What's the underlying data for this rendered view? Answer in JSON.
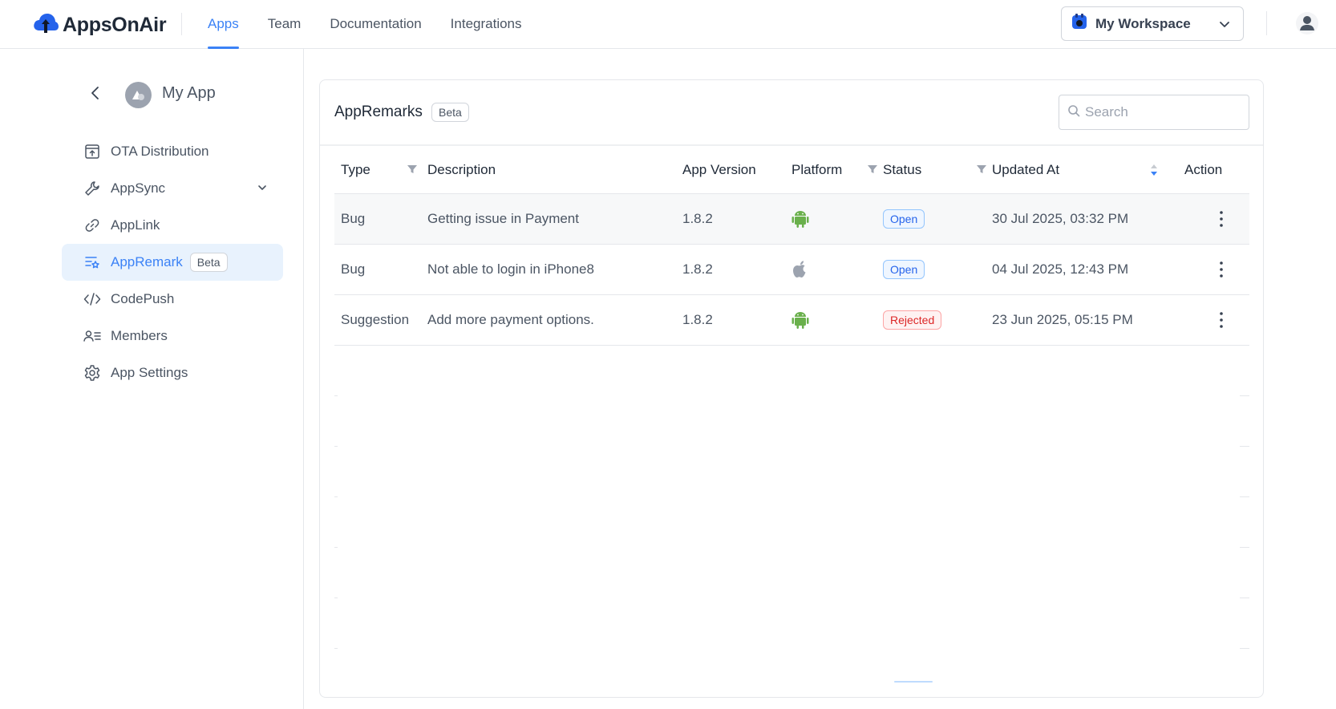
{
  "app": {
    "logo_text": "AppsOnAir"
  },
  "nav": {
    "items": [
      {
        "label": "Apps",
        "active": true
      },
      {
        "label": "Team",
        "active": false
      },
      {
        "label": "Documentation",
        "active": false
      },
      {
        "label": "Integrations",
        "active": false
      }
    ]
  },
  "workspace": {
    "label": "My Workspace",
    "icon": "workspace-icon"
  },
  "sidebar": {
    "app_name": "My App",
    "items": [
      {
        "label": "OTA Distribution",
        "icon": "upload-box-icon"
      },
      {
        "label": "AppSync",
        "icon": "wrench-icon",
        "expandable": true
      },
      {
        "label": "AppLink",
        "icon": "link-icon"
      },
      {
        "label": "AppRemark",
        "icon": "list-star-icon",
        "badge": "Beta",
        "active": true
      },
      {
        "label": "CodePush",
        "icon": "code-icon"
      },
      {
        "label": "Members",
        "icon": "members-icon"
      },
      {
        "label": "App Settings",
        "icon": "gear-icon"
      }
    ]
  },
  "card": {
    "title": "AppRemarks",
    "badge": "Beta",
    "search_placeholder": "Search"
  },
  "table": {
    "columns": [
      "Type",
      "Description",
      "App Version",
      "Platform",
      "Status",
      "Updated At",
      "Action"
    ],
    "rows": [
      {
        "type": "Bug",
        "description": "Getting issue in Payment",
        "version": "1.8.2",
        "platform": "android",
        "status": "Open",
        "updated": "30 Jul 2025, 03:32 PM"
      },
      {
        "type": "Bug",
        "description": "Not able to login in iPhone8",
        "version": "1.8.2",
        "platform": "ios",
        "status": "Open",
        "updated": "04 Jul 2025, 12:43 PM"
      },
      {
        "type": "Suggestion",
        "description": "Add more payment options.",
        "version": "1.8.2",
        "platform": "android",
        "status": "Rejected",
        "updated": "23 Jun 2025, 05:15 PM"
      }
    ]
  },
  "colors": {
    "accent": "#3b82f6",
    "android": "#6ab04c",
    "apple": "#9ca3af",
    "open": "#2563eb",
    "rejected": "#dc2626"
  }
}
